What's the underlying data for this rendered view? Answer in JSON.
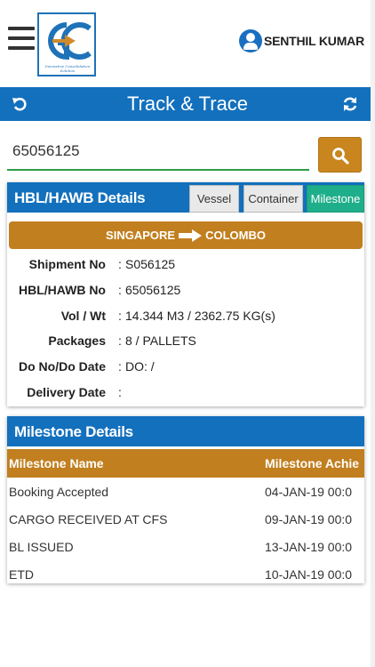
{
  "header": {
    "user_name": "SENTHIL KUMAR",
    "logo_letters": "GC",
    "logo_tagline": "Innovative Consolidation Solution"
  },
  "title_bar": {
    "title": "Track & Trace"
  },
  "search": {
    "value": "65056125"
  },
  "details": {
    "heading": "HBL/HAWB Details",
    "tabs": [
      "Vessel",
      "Container",
      "Milestone"
    ],
    "route_from": "SINGAPORE",
    "route_to": "COLOMBO",
    "rows": [
      {
        "label": "Shipment No",
        "sep": ":",
        "value": "S056125"
      },
      {
        "label": "HBL/HAWB No",
        "sep": ":",
        "value": "65056125"
      },
      {
        "label": "Vol / Wt",
        "sep": ":",
        "value": "14.344 M3 / 2362.75 KG(s)"
      },
      {
        "label": "Packages",
        "sep": ":",
        "value": "8 / PALLETS"
      },
      {
        "label": "Do No/Do Date",
        "sep": ":",
        "value": "DO: /"
      },
      {
        "label": "Delivery Date",
        "sep": ":",
        "value": ""
      }
    ]
  },
  "milestones": {
    "heading": "Milestone Details",
    "columns": [
      "Milestone Name",
      "Milestone Achie"
    ],
    "rows": [
      {
        "name": "Booking Accepted",
        "date": "04-JAN-19 00:0"
      },
      {
        "name": "CARGO RECEIVED AT CFS",
        "date": "09-JAN-19 00:0"
      },
      {
        "name": "BL ISSUED",
        "date": "13-JAN-19 00:0"
      },
      {
        "name": "ETD",
        "date": "10-JAN-19 00:0"
      }
    ]
  },
  "colors": {
    "primary_blue": "#1370bd",
    "accent_orange": "#c17f1f",
    "milestone_green": "#1fae8a",
    "search_underline": "#2e9d46"
  }
}
